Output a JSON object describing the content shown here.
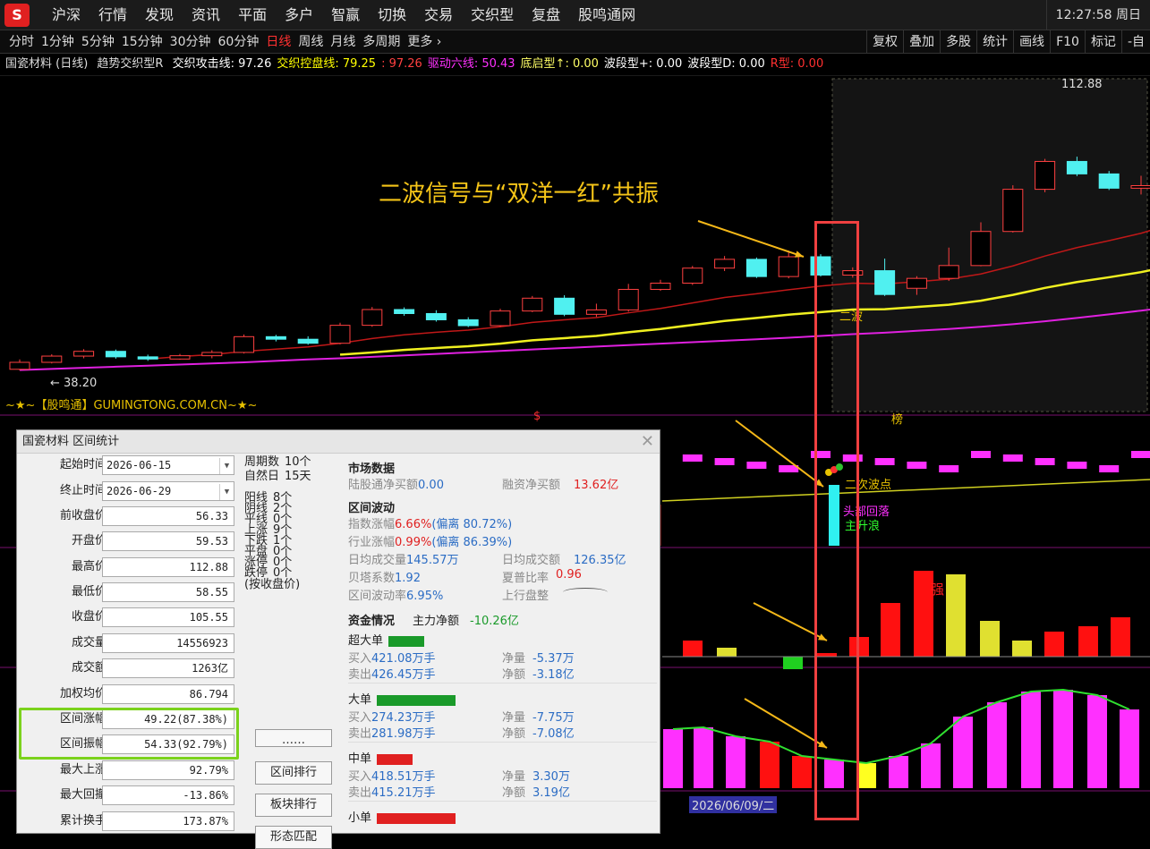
{
  "app": {
    "logo": "S",
    "menu": [
      "沪深",
      "行情",
      "发现",
      "资讯",
      "平面",
      "多户",
      "智赢",
      "切换",
      "交易",
      "交织型",
      "复盘",
      "股鸣通网"
    ],
    "clock": "12:27:58 周日"
  },
  "periods": {
    "items": [
      "分时",
      "1分钟",
      "5分钟",
      "15分钟",
      "30分钟",
      "60分钟",
      "日线",
      "周线",
      "月线",
      "多周期",
      "更多 ›"
    ],
    "active": "日线"
  },
  "tools": [
    "复权",
    "叠加",
    "多股",
    "统计",
    "画线",
    "F10",
    "标记",
    "-自"
  ],
  "legend": {
    "stock": "国瓷材料 (日线)",
    "indicator": "趋势交织型R",
    "items": [
      {
        "text": "交织攻击线: 97.26",
        "color": "#ffffff"
      },
      {
        "text": "交织控盘线: 79.25",
        "color": "#ffff00"
      },
      {
        "text": ": 97.26",
        "color": "#ff4040"
      },
      {
        "text": "驱动六线: 50.43",
        "color": "#ff30ff"
      },
      {
        "text": "底启型↑: 0.00",
        "color": "#ffff66"
      },
      {
        "text": "波段型+: 0.00",
        "color": "#ffffff"
      },
      {
        "text": "波段型D: 0.00",
        "color": "#ffffff"
      },
      {
        "text": "R型: 0.00",
        "color": "#ff3030"
      }
    ]
  },
  "annotation": {
    "title": "二波信号与“双洋一红”共振",
    "second_wave_label": "二波",
    "second_wave_point": "二次波点",
    "label_fall": "头部回落",
    "label_main": "主升浪",
    "strong": "强",
    "bang": "榜",
    "date_label": "2026/06/09/二",
    "price_high": "112.88",
    "price_low": "← 38.20",
    "watermark": "~★~【股鸣通】GUMINGTONG.COM.CN~★~",
    "dollar": "$"
  },
  "chart_data": {
    "type": "candlestick",
    "candles": [
      [
        38.2,
        40.1,
        37.9,
        40.9
      ],
      [
        40.1,
        41.8,
        39.8,
        42.3
      ],
      [
        41.8,
        43.1,
        41.2,
        43.7
      ],
      [
        43.1,
        41.6,
        41.1,
        43.6
      ],
      [
        41.6,
        41.0,
        40.5,
        42.2
      ],
      [
        41.0,
        41.9,
        40.8,
        42.4
      ],
      [
        41.9,
        42.8,
        41.2,
        43.4
      ],
      [
        42.8,
        47.1,
        42.5,
        47.7
      ],
      [
        47.1,
        46.4,
        45.8,
        47.6
      ],
      [
        46.4,
        45.3,
        44.9,
        47.2
      ],
      [
        45.3,
        50.2,
        45.0,
        50.9
      ],
      [
        50.2,
        54.5,
        49.8,
        55.2
      ],
      [
        54.5,
        53.4,
        52.8,
        55.1
      ],
      [
        53.4,
        51.7,
        51.2,
        54.3
      ],
      [
        51.7,
        50.1,
        49.7,
        52.4
      ],
      [
        50.1,
        54.1,
        49.8,
        54.7
      ],
      [
        54.1,
        57.6,
        53.8,
        58.2
      ],
      [
        57.6,
        53.2,
        52.7,
        58.4
      ],
      [
        53.2,
        54.4,
        52.5,
        56.1
      ],
      [
        54.4,
        60.0,
        53.9,
        61.5
      ],
      [
        60.0,
        61.7,
        59.6,
        62.6
      ],
      [
        61.7,
        65.8,
        61.2,
        66.4
      ],
      [
        65.8,
        68.2,
        65.0,
        69.1
      ],
      [
        68.2,
        63.5,
        63.1,
        68.7
      ],
      [
        63.5,
        68.9,
        63.0,
        70.6
      ],
      [
        68.9,
        63.9,
        63.5,
        69.6
      ],
      [
        63.9,
        65.1,
        63.2,
        66.0
      ],
      [
        65.1,
        58.6,
        58.2,
        68.4
      ],
      [
        60.3,
        63.0,
        58.5,
        63.6
      ],
      [
        63.0,
        66.5,
        62.3,
        71.4
      ],
      [
        66.5,
        75.8,
        66.3,
        78.3
      ],
      [
        75.8,
        87.3,
        75.5,
        88.4
      ],
      [
        87.3,
        94.9,
        86.5,
        95.6
      ],
      [
        94.9,
        91.5,
        90.9,
        96.2
      ],
      [
        91.5,
        87.6,
        87.1,
        92.3
      ],
      [
        87.6,
        88.3,
        85.9,
        91.0
      ],
      [
        88.3,
        94.7,
        82.6,
        95.5
      ],
      [
        94.7,
        100.3,
        94.1,
        103.1
      ],
      [
        100.3,
        105.55,
        99.5,
        112.88
      ]
    ],
    "ma_attack": [
      null,
      null,
      null,
      null,
      41.0,
      41.7,
      42.2,
      43.1,
      43.7,
      44.3,
      45.3,
      46.6,
      47.6,
      48.3,
      48.9,
      49.8,
      51.0,
      51.7,
      52.3,
      53.6,
      54.8,
      56.3,
      57.8,
      58.8,
      59.9,
      60.9,
      61.7,
      61.5,
      62.1,
      62.8,
      64.2,
      66.4,
      69.1,
      71.4,
      73.3,
      75.3,
      78.0,
      81.4,
      85.0
    ],
    "ma_control": [
      null,
      null,
      null,
      null,
      null,
      null,
      null,
      null,
      null,
      null,
      42.2,
      42.8,
      43.5,
      44.0,
      44.5,
      45.2,
      46.1,
      46.7,
      47.3,
      48.3,
      49.2,
      50.3,
      51.4,
      52.2,
      53.1,
      53.8,
      54.5,
      54.6,
      55.2,
      55.8,
      56.9,
      58.5,
      60.4,
      62.0,
      63.3,
      64.7,
      66.5,
      68.6,
      70.8
    ],
    "ma_drive": [
      38.0,
      38.3,
      38.6,
      38.9,
      39.2,
      39.5,
      39.8,
      40.1,
      40.5,
      40.9,
      41.2,
      41.6,
      42.0,
      42.4,
      42.8,
      43.2,
      43.6,
      44.0,
      44.4,
      44.8,
      45.2,
      45.6,
      46.0,
      46.4,
      46.8,
      47.3,
      47.8,
      48.2,
      48.7,
      49.2,
      49.8,
      50.5,
      51.3,
      52.2,
      53.2,
      54.2,
      55.3,
      56.5,
      57.9
    ],
    "vol_sig": [
      3,
      2,
      -2,
      1,
      2,
      3,
      4,
      5,
      5,
      8,
      5,
      4,
      3,
      -2,
      1,
      3,
      6,
      9,
      12,
      8,
      6,
      4,
      2,
      1,
      2,
      5
    ],
    "osc": [
      8,
      7,
      6,
      5,
      6,
      5,
      4,
      6,
      7,
      6,
      5,
      3,
      2,
      3,
      2,
      1,
      2,
      3,
      5,
      7,
      9,
      10,
      10,
      9,
      8,
      6
    ]
  },
  "dialog": {
    "title": "国瓷材料 区间统计",
    "left": [
      {
        "label": "起始时间",
        "value": "2026-06-15",
        "dropdown": true
      },
      {
        "label": "终止时间",
        "value": "2026-06-29",
        "dropdown": true
      },
      {
        "label": "前收盘价",
        "value": "56.33"
      },
      {
        "label": "开盘价",
        "value": "59.53"
      },
      {
        "label": "最高价",
        "value": "112.88"
      },
      {
        "label": "最低价",
        "value": "58.55"
      },
      {
        "label": "收盘价",
        "value": "105.55"
      },
      {
        "label": "成交量",
        "value": "14556923"
      },
      {
        "label": "成交额",
        "value": "1263亿"
      },
      {
        "label": "加权均价",
        "value": "86.794"
      },
      {
        "label": "区间涨幅",
        "value": "49.22(87.38%)"
      },
      {
        "label": "区间振幅",
        "value": "54.33(92.79%)"
      },
      {
        "label": "最大上涨",
        "value": "92.79%"
      },
      {
        "label": "最大回撤",
        "value": "-13.86%"
      },
      {
        "label": "累计换手",
        "value": "173.87%"
      }
    ],
    "mid": [
      {
        "k": "周期数",
        "v": "10个"
      },
      {
        "k": "自然日",
        "v": "15天"
      },
      {
        "k": "阳线",
        "v": "8个"
      },
      {
        "k": "阴线",
        "v": "2个"
      },
      {
        "k": "平线",
        "v": "0个"
      },
      {
        "k": "上涨",
        "v": "9个"
      },
      {
        "k": "下跌",
        "v": "1个"
      },
      {
        "k": "平盘",
        "v": "0个"
      },
      {
        "k": "涨停",
        "v": "0个"
      },
      {
        "k": "跌停",
        "v": "0个"
      }
    ],
    "mid_note": "(按收盘价)",
    "buttons": [
      "……",
      "区间排行",
      "板块排行",
      "形态匹配"
    ],
    "market": {
      "title": "市场数据",
      "lgt_label": "陆股通净买额",
      "lgt": "0.00",
      "rz_label": "融资净买额",
      "rz": "13.62亿"
    },
    "wave": {
      "title": "区间波动",
      "idx_label": "指数涨幅",
      "idx": "6.66%",
      "idx_dev": "(偏离 80.72%)",
      "ind_label": "行业涨幅",
      "ind": "0.99%",
      "ind_dev": "(偏离 86.39%)",
      "avgvol_label": "日均成交量",
      "avgvol": "145.57万",
      "avgamt_label": "日均成交额",
      "avgamt": "126.35亿",
      "beta_label": "贝塔系数",
      "beta": "1.92",
      "sharpe_label": "夏普比率",
      "sharpe": "0.96",
      "volat_label": "区间波动率",
      "volat": "6.95%",
      "trend_label": "上行盘整"
    },
    "fund": {
      "title": "资金情况",
      "main_label": "主力净额",
      "main": "-10.26亿",
      "groups": [
        {
          "name": "超大单",
          "color": "#1a9a2a",
          "buy": "421.08万手",
          "sell": "426.45万手",
          "netv": "-5.37万",
          "neta": "-3.18亿"
        },
        {
          "name": "大单",
          "color": "#1a9a2a",
          "buy": "274.23万手",
          "sell": "281.98万手",
          "netv": "-7.75万",
          "neta": "-7.08亿"
        },
        {
          "name": "中单",
          "color": "#e02020",
          "buy": "418.51万手",
          "sell": "415.21万手",
          "netv": "3.30万",
          "neta": "3.19亿"
        },
        {
          "name": "小单",
          "color": "#e02020"
        }
      ],
      "buy_label": "买入",
      "sell_label": "卖出",
      "netv_label": "净量",
      "neta_label": "净额"
    }
  }
}
